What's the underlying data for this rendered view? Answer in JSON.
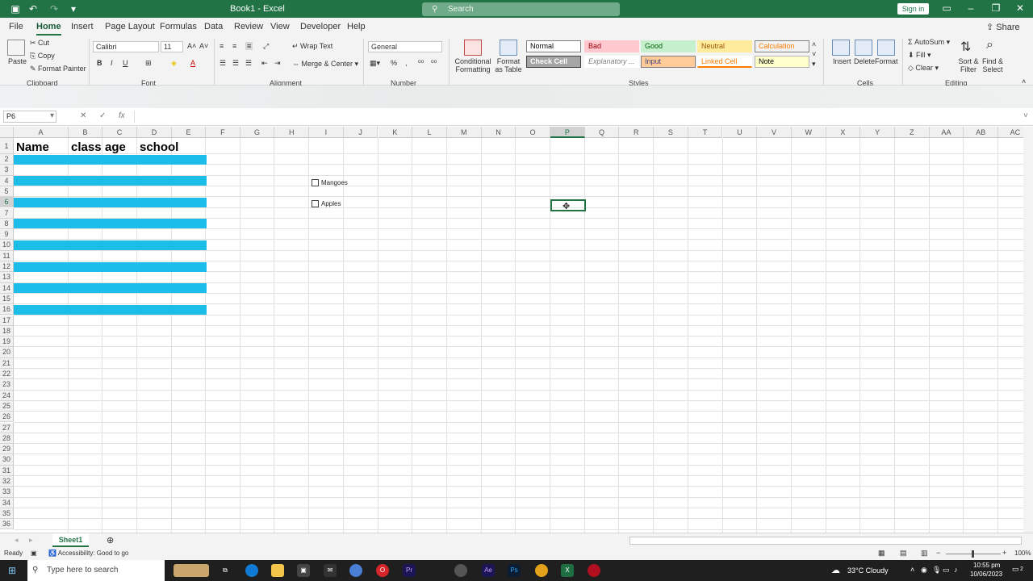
{
  "window": {
    "title": "Book1  -  Excel",
    "search_placeholder": "Search",
    "sign_in": "Sign in"
  },
  "menu": {
    "tabs": [
      "File",
      "Home",
      "Insert",
      "Page Layout",
      "Formulas",
      "Data",
      "Review",
      "View",
      "Developer",
      "Help"
    ],
    "active": "Home",
    "share": "Share"
  },
  "ribbon": {
    "clipboard": {
      "paste": "Paste",
      "cut": "Cut",
      "copy": "Copy",
      "format_painter": "Format Painter",
      "label": "Clipboard"
    },
    "font": {
      "name": "Calibri",
      "size": "11",
      "label": "Font"
    },
    "alignment": {
      "wrap": "Wrap Text",
      "merge": "Merge & Center",
      "label": "Alignment"
    },
    "number": {
      "format": "General",
      "label": "Number"
    },
    "styles": {
      "cond": "Conditional Formatting",
      "fmt_table": "Format as Table",
      "label": "Styles",
      "cells": [
        {
          "text": "Normal",
          "bg": "#ffffff",
          "fg": "#000000",
          "border": "#7f7f7f"
        },
        {
          "text": "Bad",
          "bg": "#ffc7ce",
          "fg": "#9c0006",
          "border": "#ffc7ce"
        },
        {
          "text": "Good",
          "bg": "#c6efce",
          "fg": "#006100",
          "border": "#c6efce"
        },
        {
          "text": "Neutral",
          "bg": "#ffeb9c",
          "fg": "#9c5700",
          "border": "#ffeb9c"
        },
        {
          "text": "Calculation",
          "bg": "#f2f2f2",
          "fg": "#fa7d00",
          "border": "#7f7f7f"
        },
        {
          "text": "Check Cell",
          "bg": "#a5a5a5",
          "fg": "#ffffff",
          "border": "#3f3f3f"
        },
        {
          "text": "Explanatory ...",
          "bg": "#ffffff",
          "fg": "#7f7f7f",
          "border": "#ffffff"
        },
        {
          "text": "Input",
          "bg": "#ffcc99",
          "fg": "#3f3f76",
          "border": "#7f7f7f"
        },
        {
          "text": "Linked Cell",
          "bg": "#ffffff",
          "fg": "#fa7d00",
          "border": "#ffffff"
        },
        {
          "text": "Note",
          "bg": "#ffffcc",
          "fg": "#000000",
          "border": "#b2b2b2"
        }
      ]
    },
    "cells": {
      "insert": "Insert",
      "delete": "Delete",
      "format": "Format",
      "label": "Cells"
    },
    "editing": {
      "autosum": "AutoSum",
      "fill": "Fill",
      "clear": "Clear",
      "sort": "Sort & Filter",
      "find": "Find & Select",
      "label": "Editing"
    }
  },
  "formula_bar": {
    "cell_ref": "P6",
    "fx": "fx",
    "value": ""
  },
  "columns": [
    "A",
    "B",
    "C",
    "D",
    "E",
    "F",
    "G",
    "H",
    "I",
    "J",
    "K",
    "L",
    "M",
    "N",
    "O",
    "P",
    "Q",
    "R",
    "S",
    "T",
    "U",
    "V",
    "W",
    "X",
    "Y",
    "Z",
    "AA",
    "AB",
    "AC"
  ],
  "selected_column": "P",
  "rows": 36,
  "selected_row": 6,
  "header_row": {
    "A": "Name",
    "B": "class",
    "C": "age",
    "D": "school"
  },
  "banded_rows": [
    2,
    4,
    6,
    8,
    10,
    12,
    14,
    16
  ],
  "band_color": "#1dbdea",
  "checkboxes": [
    {
      "label": "Mangoes",
      "checked": false
    },
    {
      "label": "Apples",
      "checked": false
    }
  ],
  "sheet": {
    "tab": "Sheet1"
  },
  "status": {
    "ready": "Ready",
    "accessibility": "Accessibility: Good to go",
    "zoom": "100%"
  },
  "taskbar": {
    "search": "Type here to search",
    "weather": "33°C  Cloudy",
    "time": "10:55 pm",
    "date": "10/06/2023",
    "notif": "2"
  }
}
